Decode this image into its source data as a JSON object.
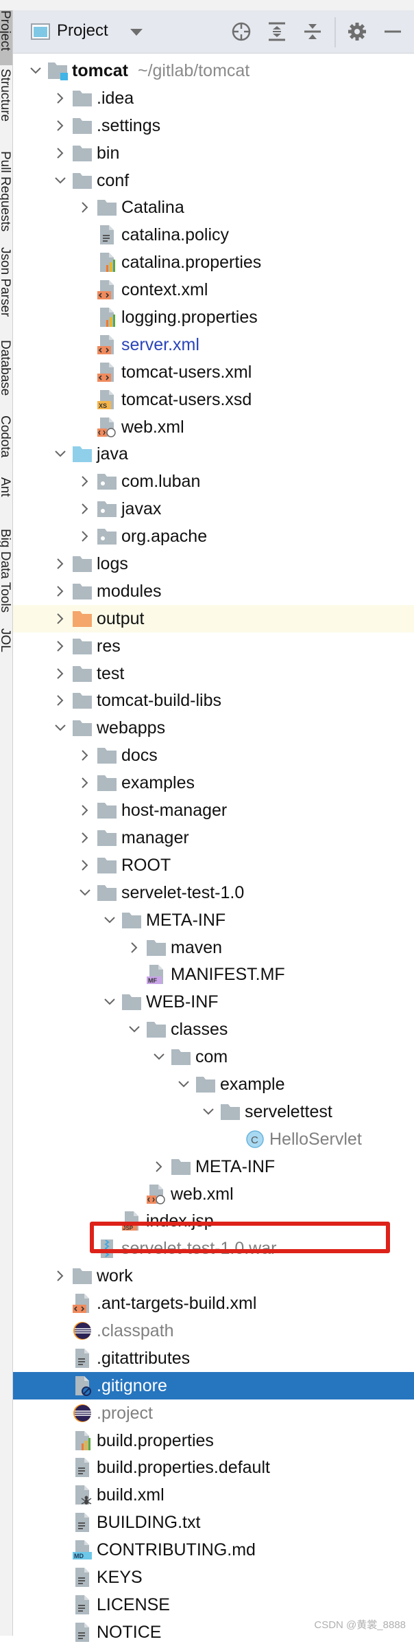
{
  "sidebar": {
    "tabs": [
      {
        "label": "Project",
        "active": true
      },
      {
        "label": "Structure"
      },
      {
        "label": "Pull Requests"
      },
      {
        "label": "Json Parser"
      },
      {
        "label": "Database"
      },
      {
        "label": "Codota"
      },
      {
        "label": "Ant"
      },
      {
        "label": "Big Data Tools"
      },
      {
        "label": "JOL"
      }
    ]
  },
  "header": {
    "title": "Project",
    "icons": [
      "dropdown-arrow-icon",
      "locate-icon",
      "expand-all-icon",
      "collapse-all-icon",
      "gear-icon",
      "minimize-icon"
    ]
  },
  "tree": {
    "root": {
      "label": "tomcat",
      "path": "~/gitlab/tomcat"
    },
    "rows": [
      {
        "level": 1,
        "label": ".idea",
        "state": "closed",
        "icon": "folder"
      },
      {
        "level": 1,
        "label": ".settings",
        "state": "closed",
        "icon": "folder"
      },
      {
        "level": 1,
        "label": "bin",
        "state": "closed",
        "icon": "folder"
      },
      {
        "level": 1,
        "label": "conf",
        "state": "open",
        "icon": "folder"
      },
      {
        "level": 2,
        "label": "Catalina",
        "state": "closed",
        "icon": "folder"
      },
      {
        "level": 2,
        "label": "catalina.policy",
        "icon": "text-file"
      },
      {
        "level": 2,
        "label": "catalina.properties",
        "icon": "properties-file"
      },
      {
        "level": 2,
        "label": "context.xml",
        "icon": "xml-file"
      },
      {
        "level": 2,
        "label": "logging.properties",
        "icon": "properties-file"
      },
      {
        "level": 2,
        "label": "server.xml",
        "icon": "xml-file",
        "style": "blue"
      },
      {
        "level": 2,
        "label": "tomcat-users.xml",
        "icon": "xml-file"
      },
      {
        "level": 2,
        "label": "tomcat-users.xsd",
        "icon": "xsd-file"
      },
      {
        "level": 2,
        "label": "web.xml",
        "icon": "webxml-file"
      },
      {
        "level": 1,
        "label": "java",
        "state": "open",
        "icon": "source-folder"
      },
      {
        "level": 2,
        "label": "com.luban",
        "state": "closed",
        "icon": "package"
      },
      {
        "level": 2,
        "label": "javax",
        "state": "closed",
        "icon": "package"
      },
      {
        "level": 2,
        "label": "org.apache",
        "state": "closed",
        "icon": "package"
      },
      {
        "level": 1,
        "label": "logs",
        "state": "closed",
        "icon": "folder"
      },
      {
        "level": 1,
        "label": "modules",
        "state": "closed",
        "icon": "folder"
      },
      {
        "level": 1,
        "label": "output",
        "state": "closed",
        "icon": "output-folder",
        "highlight": true
      },
      {
        "level": 1,
        "label": "res",
        "state": "closed",
        "icon": "folder"
      },
      {
        "level": 1,
        "label": "test",
        "state": "closed",
        "icon": "folder"
      },
      {
        "level": 1,
        "label": "tomcat-build-libs",
        "state": "closed",
        "icon": "folder"
      },
      {
        "level": 1,
        "label": "webapps",
        "state": "open",
        "icon": "folder"
      },
      {
        "level": 2,
        "label": "docs",
        "state": "closed",
        "icon": "folder"
      },
      {
        "level": 2,
        "label": "examples",
        "state": "closed",
        "icon": "folder"
      },
      {
        "level": 2,
        "label": "host-manager",
        "state": "closed",
        "icon": "folder"
      },
      {
        "level": 2,
        "label": "manager",
        "state": "closed",
        "icon": "folder"
      },
      {
        "level": 2,
        "label": "ROOT",
        "state": "closed",
        "icon": "folder"
      },
      {
        "level": 2,
        "label": "servelet-test-1.0",
        "state": "open",
        "icon": "folder"
      },
      {
        "level": 3,
        "label": "META-INF",
        "state": "open",
        "icon": "folder"
      },
      {
        "level": 4,
        "label": "maven",
        "state": "closed",
        "icon": "folder"
      },
      {
        "level": 4,
        "label": "MANIFEST.MF",
        "icon": "manifest-file"
      },
      {
        "level": 3,
        "label": "WEB-INF",
        "state": "open",
        "icon": "folder"
      },
      {
        "level": 4,
        "label": "classes",
        "state": "open",
        "icon": "folder"
      },
      {
        "level": 5,
        "label": "com",
        "state": "open",
        "icon": "folder"
      },
      {
        "level": 6,
        "label": "example",
        "state": "open",
        "icon": "folder"
      },
      {
        "level": 7,
        "label": "servelettest",
        "state": "open",
        "icon": "folder"
      },
      {
        "level": 8,
        "label": "HelloServlet",
        "icon": "class-file",
        "style": "muted"
      },
      {
        "level": 5,
        "label": "META-INF",
        "state": "closed",
        "icon": "folder"
      },
      {
        "level": 4,
        "label": "web.xml",
        "icon": "webxml-file"
      },
      {
        "level": 3,
        "label": "index.jsp",
        "icon": "jsp-file"
      },
      {
        "level": 2,
        "label": "servelet-test-1.0.war",
        "icon": "archive-file",
        "style": "muted",
        "boxed": true
      },
      {
        "level": 1,
        "label": "work",
        "state": "closed",
        "icon": "folder"
      },
      {
        "level": 1,
        "label": ".ant-targets-build.xml",
        "icon": "xml-file"
      },
      {
        "level": 1,
        "label": ".classpath",
        "icon": "eclipse-file",
        "style": "muted"
      },
      {
        "level": 1,
        "label": ".gitattributes",
        "icon": "text-file"
      },
      {
        "level": 1,
        "label": ".gitignore",
        "icon": "ignore-file",
        "selected": true
      },
      {
        "level": 1,
        "label": ".project",
        "icon": "eclipse-file",
        "style": "muted"
      },
      {
        "level": 1,
        "label": "build.properties",
        "icon": "properties-file"
      },
      {
        "level": 1,
        "label": "build.properties.default",
        "icon": "text-file"
      },
      {
        "level": 1,
        "label": "build.xml",
        "icon": "ant-file"
      },
      {
        "level": 1,
        "label": "BUILDING.txt",
        "icon": "text-file"
      },
      {
        "level": 1,
        "label": "CONTRIBUTING.md",
        "icon": "markdown-file"
      },
      {
        "level": 1,
        "label": "KEYS",
        "icon": "text-file"
      },
      {
        "level": 1,
        "label": "LICENSE",
        "icon": "text-file"
      },
      {
        "level": 1,
        "label": "NOTICE",
        "icon": "text-file"
      }
    ]
  },
  "colors": {
    "selection": "#2675bf",
    "highlight_box": "#dd2219",
    "folder": "#aeb9c0",
    "output_folder": "#f4a66b",
    "source_folder": "#8fcfea"
  },
  "watermark": "CSDN @黄裳_8888"
}
